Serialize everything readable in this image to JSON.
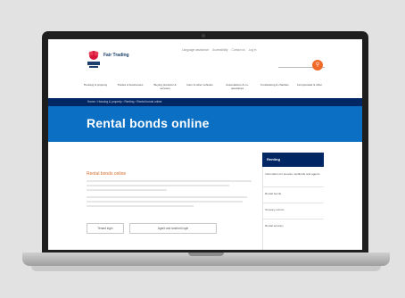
{
  "site": {
    "logo_text": "Fair Trading",
    "utility_links": [
      "Language assistance",
      "Accessibility",
      "Contact us",
      "Log in"
    ],
    "search_icon": "magnifier-icon",
    "nav_items": [
      "Housing & property",
      "Trades & businesses",
      "Buying products & services",
      "Cars & other vehicles",
      "Associations & co-operatives",
      "Fundraising & charities",
      "Incorporated & other"
    ],
    "breadcrumb": "Home  ›  Housing & property  ›  Renting  ›  Rental bonds online",
    "hero_title": "Rental bonds online",
    "content_title": "Rental bonds online",
    "buttons": [
      "Tenant login",
      "Agent and landlord login"
    ],
    "side_nav": {
      "title": "Renting",
      "items": [
        "Information for tenants, landlords and agents",
        "Rental bonds",
        "Tenancy reform",
        "Rental tenancy"
      ]
    }
  },
  "colors": {
    "navy": "#002664",
    "hero_blue": "#0b6fc3",
    "accent_orange": "#ef6a2b"
  }
}
